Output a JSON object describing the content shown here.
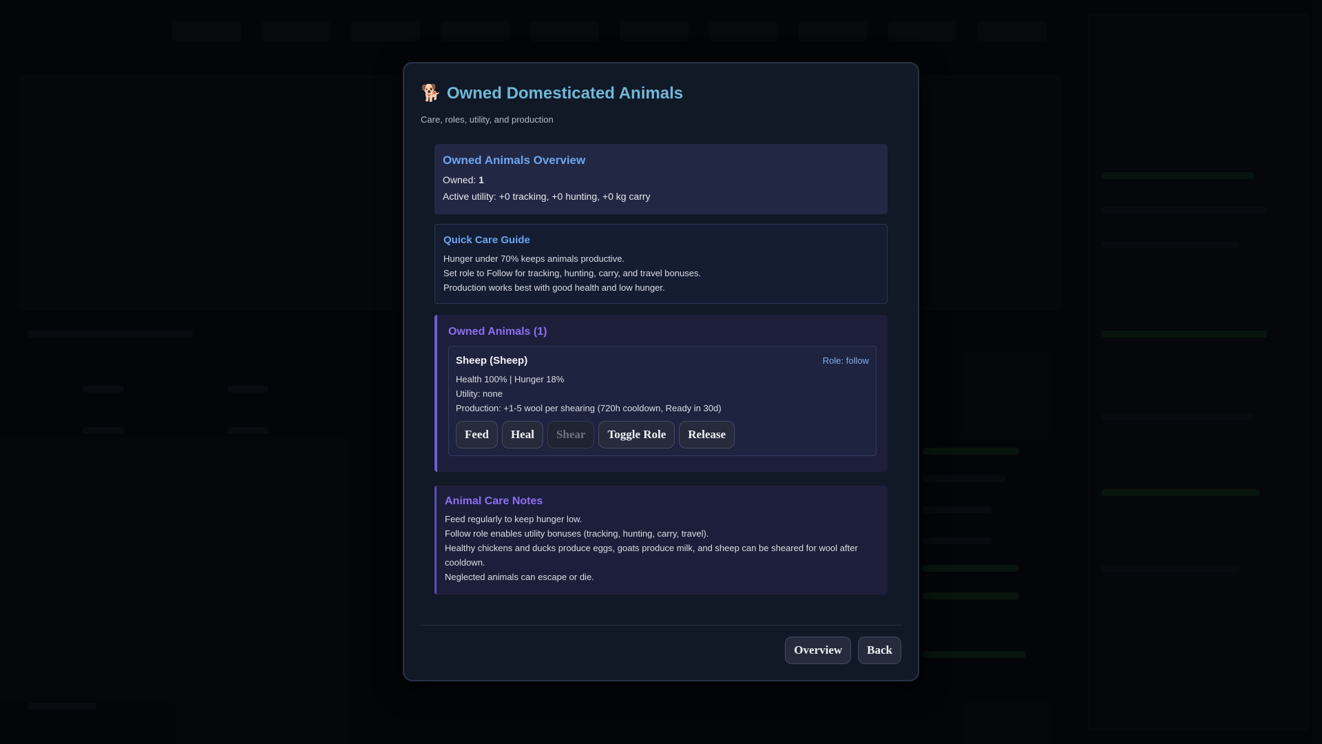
{
  "modal": {
    "icon": "dog-icon",
    "icon_glyph": "🐕",
    "title": "Owned Domesticated Animals",
    "subtitle": "Care, roles, utility, and production"
  },
  "overview": {
    "title": "Owned Animals Overview",
    "owned_label": "Owned:",
    "owned_value": "1",
    "utility": "Active utility: +0 tracking, +0 hunting, +0 kg carry"
  },
  "guide": {
    "title": "Quick Care Guide",
    "lines": [
      "Hunger under 70% keeps animals productive.",
      "Set role to Follow for tracking, hunting, carry, and travel bonuses.",
      "Production works best with good health and low hunger."
    ]
  },
  "animals": {
    "title": "Owned Animals (1)",
    "items": [
      {
        "name": "Sheep (Sheep)",
        "role": "Role: follow",
        "stats": "Health 100% | Hunger 18%",
        "utility": "Utility: none",
        "production": "Production: +1-5 wool per shearing (720h cooldown, Ready in 30d)",
        "buttons": [
          {
            "label": "Feed",
            "enabled": true
          },
          {
            "label": "Heal",
            "enabled": true
          },
          {
            "label": "Shear",
            "enabled": false
          },
          {
            "label": "Toggle Role",
            "enabled": true
          },
          {
            "label": "Release",
            "enabled": true
          }
        ]
      }
    ]
  },
  "notes": {
    "title": "Animal Care Notes",
    "lines": [
      "Feed regularly to keep hunger low.",
      "Follow role enables utility bonuses (tracking, hunting, carry, travel).",
      "Healthy chickens and ducks produce eggs, goats produce milk, and sheep can be sheared for wool after cooldown.",
      "Neglected animals can escape or die."
    ]
  },
  "footer": {
    "overview_label": "Overview",
    "back_label": "Back"
  }
}
